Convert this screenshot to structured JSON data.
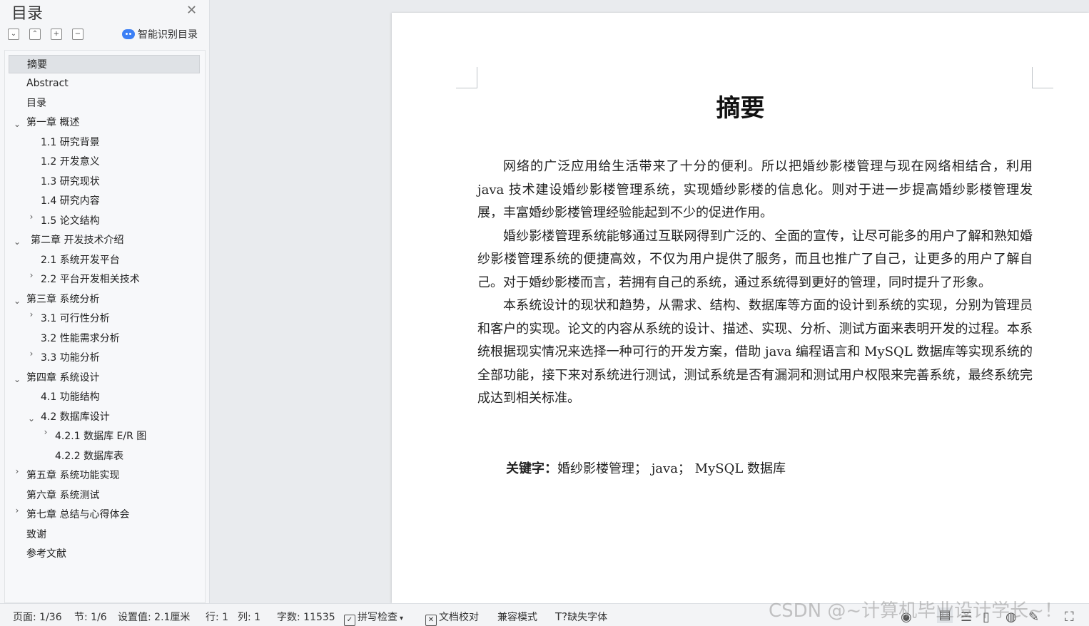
{
  "toc": {
    "title": "目录",
    "smart_toc_label": "智能识别目录",
    "toolbar_icons": [
      "collapse-all-icon",
      "expand-all-icon",
      "add-level-icon",
      "remove-level-icon"
    ],
    "items": [
      {
        "label": "摘要",
        "selected": true
      },
      {
        "label": "Abstract"
      },
      {
        "label": "目录"
      },
      {
        "label": "第一章  概述",
        "expanded": true
      },
      {
        "label": "1.1  研究背景"
      },
      {
        "label": "1.2  开发意义"
      },
      {
        "label": "1.3  研究现状"
      },
      {
        "label": "1.4  研究内容"
      },
      {
        "label": "1.5  论文结构",
        "collapsed": true
      },
      {
        "label": "第二章  开发技术介绍",
        "expanded": true
      },
      {
        "label": "2.1  系统开发平台"
      },
      {
        "label": "2.2  平台开发相关技术",
        "collapsed": true
      },
      {
        "label": "第三章  系统分析",
        "expanded": true
      },
      {
        "label": "3.1  可行性分析",
        "collapsed": true
      },
      {
        "label": "3.2 性能需求分析"
      },
      {
        "label": "3.3 功能分析",
        "collapsed": true
      },
      {
        "label": "第四章  系统设计",
        "expanded": true
      },
      {
        "label": "4.1 功能结构"
      },
      {
        "label": "4.2  数据库设计",
        "expanded": true
      },
      {
        "label": "4.2.1  数据库 E/R 图",
        "collapsed": true
      },
      {
        "label": "4.2.2  数据库表"
      },
      {
        "label": "第五章  系统功能实现",
        "collapsed": true
      },
      {
        "label": "第六章  系统测试"
      },
      {
        "label": "第七章  总结与心得体会",
        "collapsed": true
      },
      {
        "label": "致谢"
      },
      {
        "label": "参考文献"
      }
    ]
  },
  "document": {
    "title": "摘要",
    "paragraphs": [
      "网络的广泛应用给生活带来了十分的便利。所以把婚纱影楼管理与现在网络相结合，利用 java 技术建设婚纱影楼管理系统，实现婚纱影楼的信息化。则对于进一步提高婚纱影楼管理发展，丰富婚纱影楼管理经验能起到不少的促进作用。",
      "婚纱影楼管理系统能够通过互联网得到广泛的、全面的宣传，让尽可能多的用户了解和熟知婚纱影楼管理系统的便捷高效，不仅为用户提供了服务，而且也推广了自己，让更多的用户了解自己。对于婚纱影楼而言，若拥有自己的系统，通过系统得到更好的管理，同时提升了形象。",
      "本系统设计的现状和趋势，从需求、结构、数据库等方面的设计到系统的实现，分别为管理员和客户的实现。论文的内容从系统的设计、描述、实现、分析、测试方面来表明开发的过程。本系统根据现实情况来选择一种可行的开发方案，借助 java 编程语言和 MySQL 数据库等实现系统的全部功能，接下来对系统进行测试，测试系统是否有漏洞和测试用户权限来完善系统，最终系统完成达到相关标准。"
    ],
    "keywords_label": "关键字：",
    "keywords_value": "婚纱影楼管理；  java；  MySQL 数据库"
  },
  "status_bar": {
    "page": "页面: 1/36",
    "section": "节: 1/6",
    "setting": "设置值: 2.1厘米",
    "row": "行: 1",
    "col": "列: 1",
    "word_count": "字数: 11535",
    "spell_check": "拼写检查",
    "doc_proof": "文档校对",
    "compat_mode": "兼容模式",
    "missing_font": "缺失字体"
  },
  "watermark": "CSDN @~计算机毕业设计学长~！"
}
